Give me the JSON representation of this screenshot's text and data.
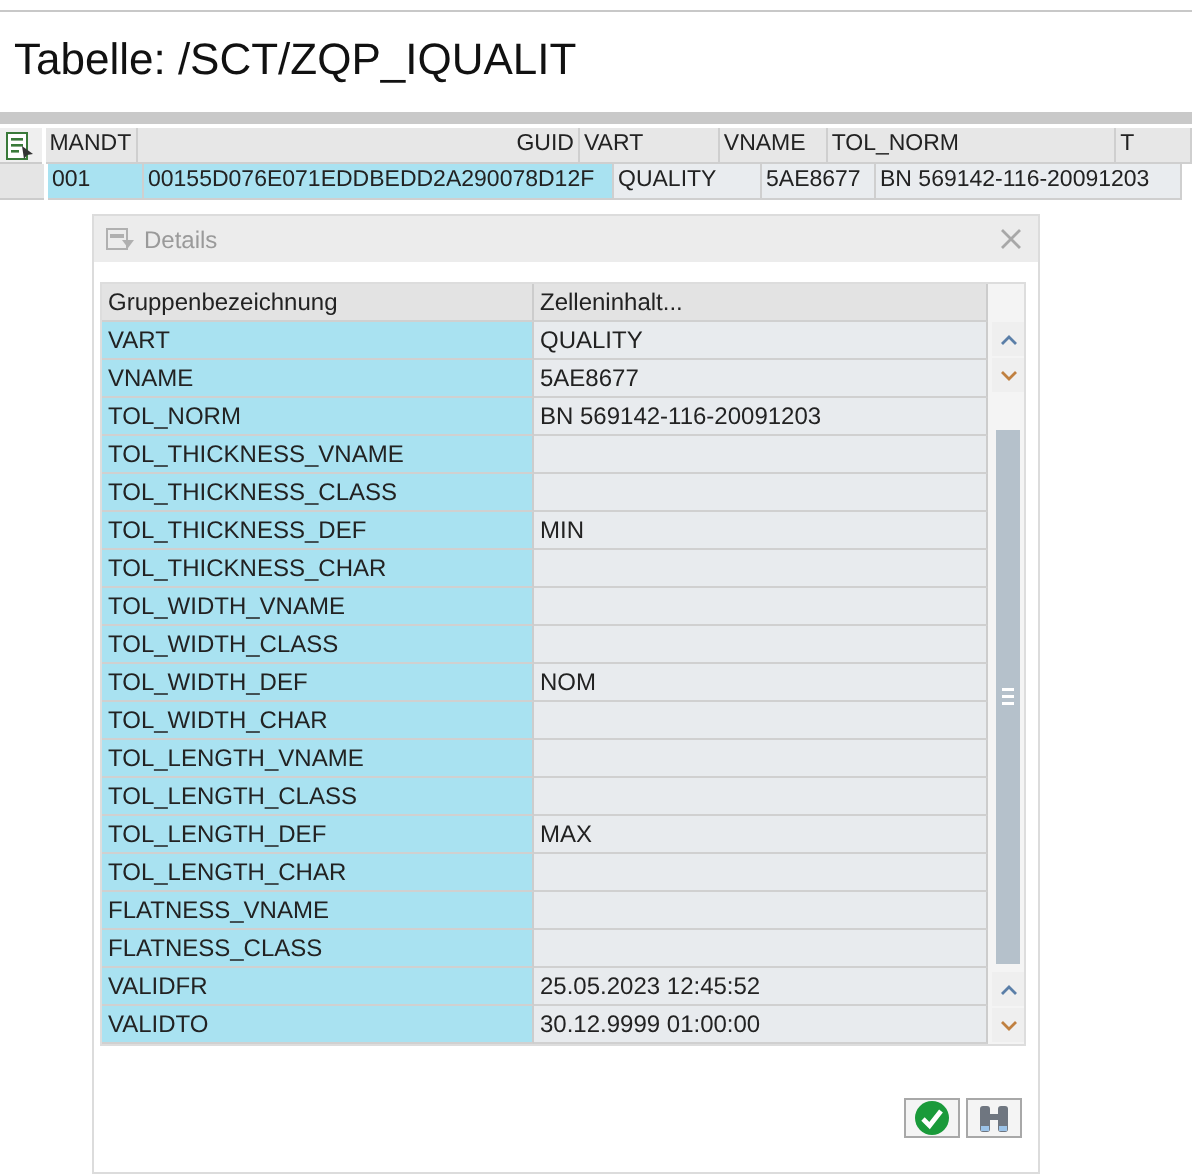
{
  "title": "Tabelle: /SCT/ZQP_IQUALIT",
  "table": {
    "columns": [
      {
        "label": "MANDT",
        "key": true,
        "right_aligned": false
      },
      {
        "label": "GUID",
        "key": true,
        "right_aligned": true
      },
      {
        "label": "VART",
        "key": false,
        "right_aligned": false
      },
      {
        "label": "VNAME",
        "key": false,
        "right_aligned": false
      },
      {
        "label": "TOL_NORM",
        "key": false,
        "right_aligned": false
      },
      {
        "label": "T",
        "right_aligned": false
      }
    ],
    "rows": [
      {
        "cells": [
          "001",
          "00155D076E071EDDBEDD2A290078D12F",
          "QUALITY",
          "5AE8677",
          "BN 569142-116-20091203"
        ]
      }
    ]
  },
  "dialog": {
    "title": "Details",
    "columns": [
      "Gruppenbezeichnung",
      "Zelleninhalt..."
    ],
    "rows": [
      {
        "name": "VART",
        "value": "QUALITY"
      },
      {
        "name": "VNAME",
        "value": "5AE8677"
      },
      {
        "name": "TOL_NORM",
        "value": "BN 569142-116-20091203"
      },
      {
        "name": "TOL_THICKNESS_VNAME"
      },
      {
        "name": "TOL_THICKNESS_CLASS"
      },
      {
        "name": "TOL_THICKNESS_DEF",
        "value": "MIN"
      },
      {
        "name": "TOL_THICKNESS_CHAR"
      },
      {
        "name": "TOL_WIDTH_VNAME"
      },
      {
        "name": "TOL_WIDTH_CLASS"
      },
      {
        "name": "TOL_WIDTH_DEF",
        "value": "NOM"
      },
      {
        "name": "TOL_WIDTH_CHAR"
      },
      {
        "name": "TOL_LENGTH_VNAME"
      },
      {
        "name": "TOL_LENGTH_CLASS"
      },
      {
        "name": "TOL_LENGTH_DEF",
        "value": "MAX"
      },
      {
        "name": "TOL_LENGTH_CHAR"
      },
      {
        "name": "FLATNESS_VNAME"
      },
      {
        "name": "FLATNESS_CLASS"
      },
      {
        "name": "VALIDFR",
        "value": "25.05.2023 12:45:52"
      },
      {
        "name": "VALIDTO",
        "value": "30.12.9999 01:00:00"
      }
    ],
    "buttons": [
      {
        "kind": "confirm"
      },
      {
        "kind": "find"
      }
    ]
  }
}
